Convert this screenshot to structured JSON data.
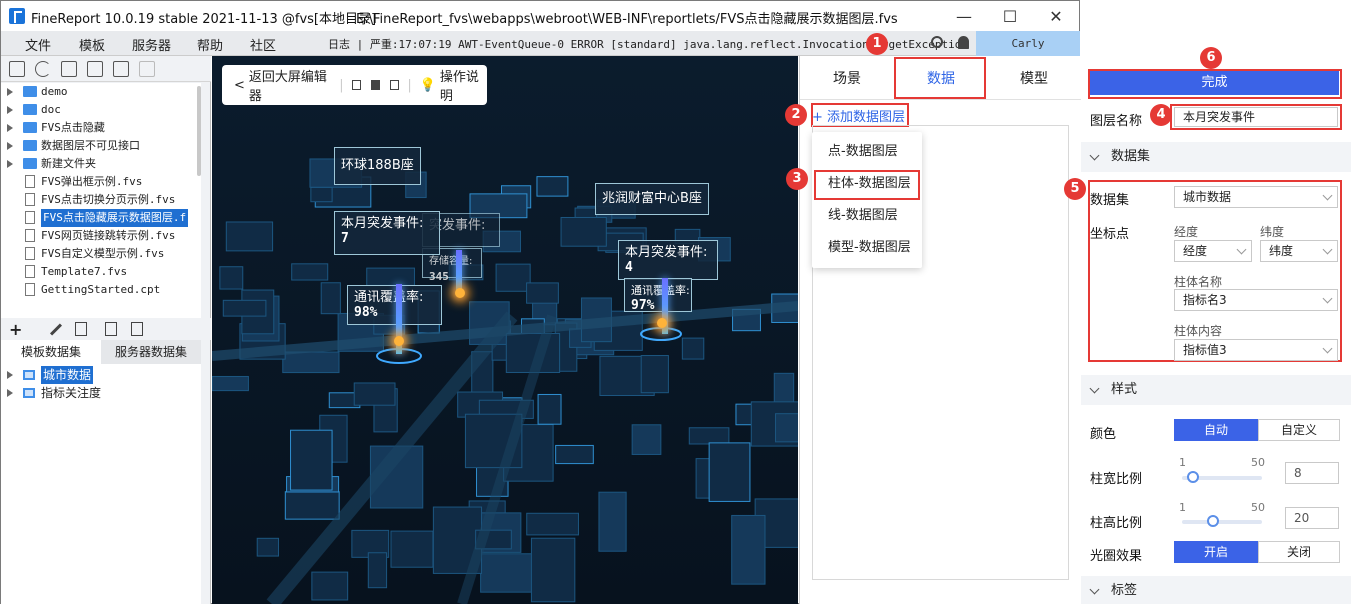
{
  "window": {
    "title": "FineReport 10.0.19 stable 2021-11-13 @fvs[本地目录]",
    "path": "E:\\FineReport_fvs\\webapps\\webroot\\WEB-INF\\reportlets/FVS点击隐藏展示数据图层.fvs",
    "min": "—",
    "max": "☐",
    "close": "✕"
  },
  "menu": [
    "文件",
    "模板",
    "服务器",
    "帮助",
    "社区"
  ],
  "log": "日志 | 严重:17:07:19 AWT-EventQueue-0 ERROR [standard] java.lang.reflect.InvocationTargetException",
  "user": "Carly",
  "tree": [
    {
      "label": "demo",
      "type": "folder"
    },
    {
      "label": "doc",
      "type": "folder"
    },
    {
      "label": "FVS点击隐藏",
      "type": "folder"
    },
    {
      "label": "数据图层不可见接口",
      "type": "folder"
    },
    {
      "label": "新建文件夹",
      "type": "folder"
    },
    {
      "label": "FVS弹出框示例.fvs",
      "type": "file"
    },
    {
      "label": "FVS点击切换分页示例.fvs",
      "type": "file"
    },
    {
      "label": "FVS点击隐藏展示数据图层.f",
      "type": "file",
      "selected": true
    },
    {
      "label": "FVS网页链接跳转示例.fvs",
      "type": "file"
    },
    {
      "label": "FVS自定义模型示例.fvs",
      "type": "file"
    },
    {
      "label": "Template7.fvs",
      "type": "file"
    },
    {
      "label": "GettingStarted.cpt",
      "type": "file"
    }
  ],
  "dstabs": [
    "模板数据集",
    "服务器数据集"
  ],
  "datasets": [
    {
      "label": "城市数据",
      "selected": true
    },
    {
      "label": "指标关注度",
      "selected": false
    }
  ],
  "scene": {
    "back": "返回大屏编辑器",
    "help": "操作说明",
    "cards": {
      "c1": "环球188B座",
      "c2_t": "本月突发事件:",
      "c2_v": "7",
      "c3_t": "突发事件:",
      "c3_v": "",
      "c4_t": "存储容量:",
      "c4_v": "345",
      "c5_t": "通讯覆盖率:",
      "c5_v": "98%",
      "c6": "兆润财富中心B座",
      "c7_t": "本月突发事件:",
      "c7_v": "4",
      "c8_t": "通讯覆盖率:",
      "c8_v": "97%"
    }
  },
  "dpanel": {
    "tabs": [
      "场景",
      "数据",
      "模型"
    ],
    "add": "添加数据图层",
    "options": [
      "点-数据图层",
      "柱体-数据图层",
      "线-数据图层",
      "模型-数据图层"
    ]
  },
  "badges": [
    "1",
    "2",
    "3",
    "4",
    "5",
    "6"
  ],
  "props": {
    "done": "完成",
    "layer_name_label": "图层名称",
    "layer_name": "本月突发事件",
    "sec_dataset": "数据集",
    "dataset_label": "数据集",
    "dataset_value": "城市数据",
    "coord_label": "坐标点",
    "lng_label": "经度",
    "lng_value": "经度",
    "lat_label": "纬度",
    "lat_value": "纬度",
    "pillar_name_label": "柱体名称",
    "pillar_name_value": "指标名3",
    "pillar_content_label": "柱体内容",
    "pillar_content_value": "指标值3",
    "sec_style": "样式",
    "color_label": "颜色",
    "color_auto": "自动",
    "color_custom": "自定义",
    "width_label": "柱宽比例",
    "width_min": "1",
    "width_max": "50",
    "width_value": "8",
    "width_level": 8,
    "height_label": "柱高比例",
    "height_min": "1",
    "height_max": "50",
    "height_value": "20",
    "height_level": 20,
    "halo_label": "光圈效果",
    "halo_on": "开启",
    "halo_off": "关闭",
    "sec_label": "标签"
  },
  "colors": {
    "accent": "#3b63e7",
    "highlight": "#e53935",
    "selected": "#1f6fd1"
  }
}
